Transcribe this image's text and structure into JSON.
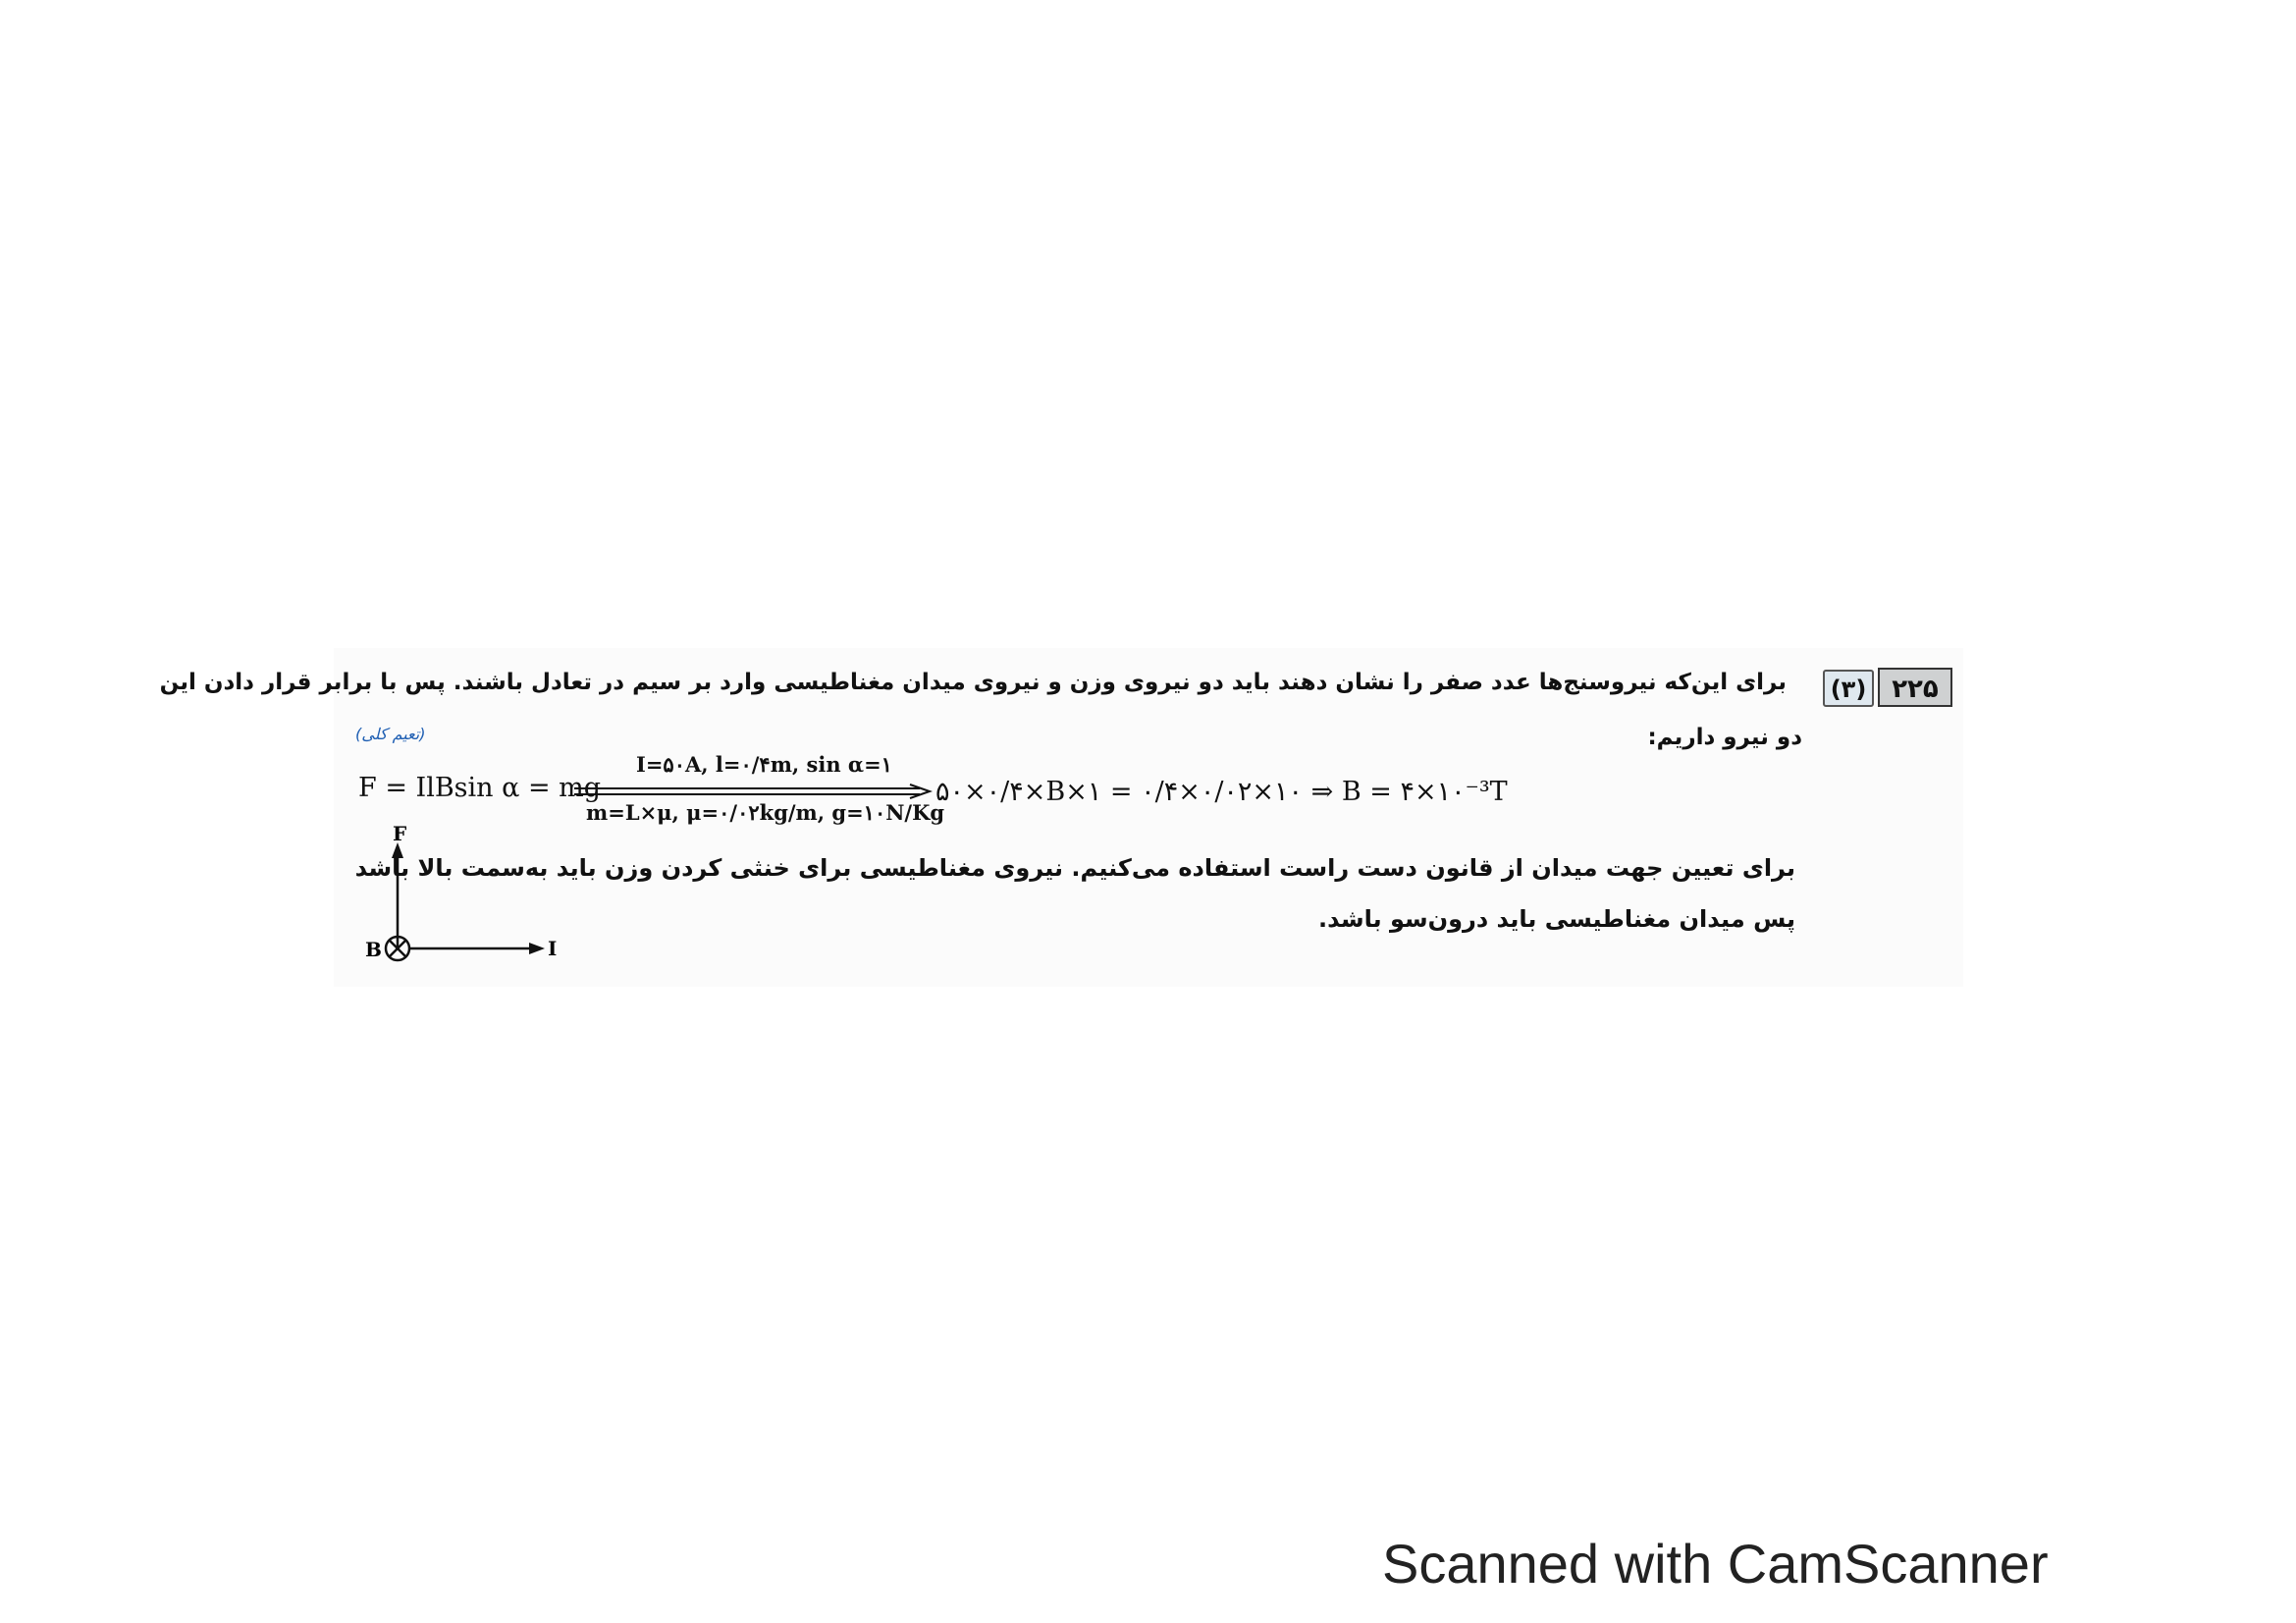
{
  "question": {
    "number": "۲۲۵",
    "option": "(۳)",
    "line1": "برای این‌که نیروسنج‌ها عدد صفر را نشان دهند باید دو نیروی وزن و نیروی میدان مغناطیسی وارد بر سیم در تعادل باشند. پس با برابر قرار دادن این",
    "line2": "دو نیرو داریم:",
    "note": "(تعیم کلی)"
  },
  "equation": {
    "left": "F = IlBsin α = mg",
    "condition_top": "I=۵۰A, l=۰/۴m, sin α=۱",
    "condition_bottom": "m=L×μ, μ=۰/۰۲kg/m, g=۱۰N/Kg",
    "right": "۵۰×۰/۴×B×۱ = ۰/۴×۰/۰۲×۱۰ ⇒ B = ۴×۱۰⁻³T"
  },
  "explanation": {
    "line1": "برای تعیین جهت میدان از قانون دست راست استفاده می‌کنیم. نیروی مغناطیسی برای خنثی کردن وزن باید به‌سمت بالا باشد",
    "line2": "پس میدان مغناطیسی باید درون‌سو باشد."
  },
  "diagram": {
    "force_label": "F",
    "field_label": "B",
    "current_label": "I"
  },
  "footer": {
    "scanner_text": "Scanned with CamScanner"
  }
}
